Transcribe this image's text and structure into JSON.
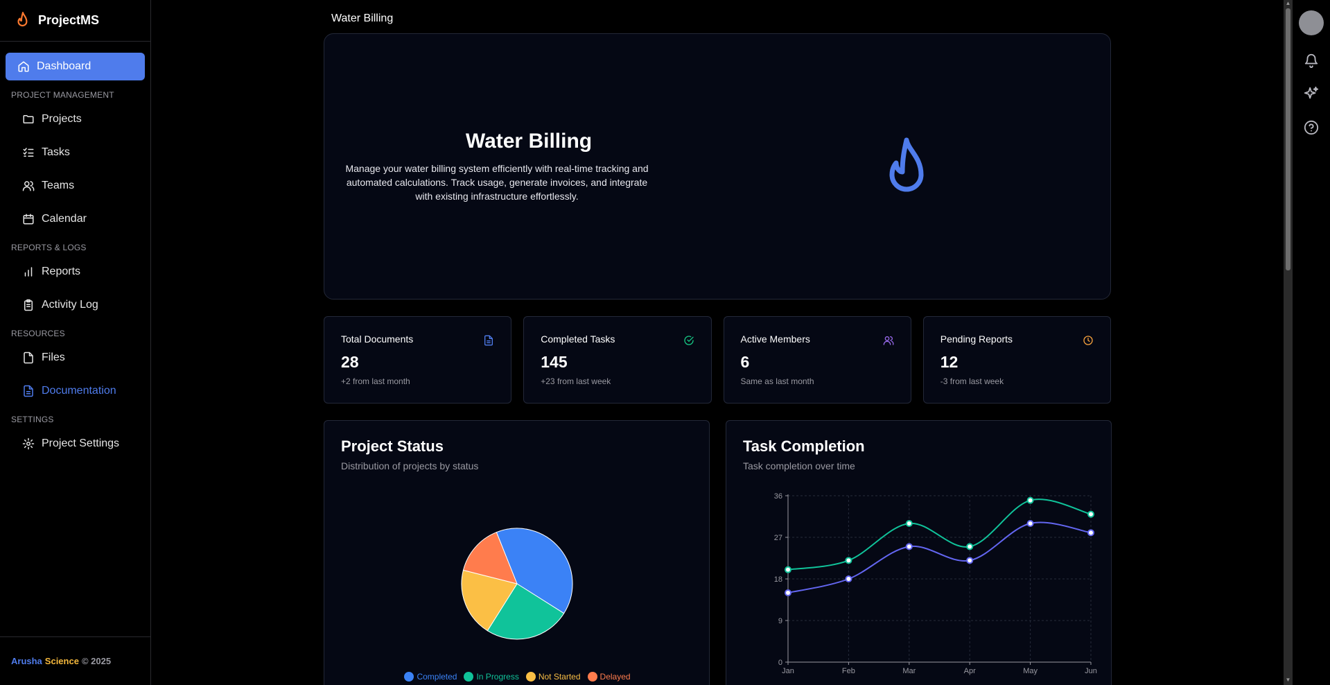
{
  "brand": {
    "name": "ProjectMS"
  },
  "sidebar": {
    "dashboard": "Dashboard",
    "sections": {
      "project_management": "PROJECT MANAGEMENT",
      "reports_logs": "REPORTS & LOGS",
      "resources": "RESOURCES",
      "settings": "SETTINGS"
    },
    "items": {
      "projects": "Projects",
      "tasks": "Tasks",
      "teams": "Teams",
      "calendar": "Calendar",
      "reports": "Reports",
      "activity_log": "Activity Log",
      "files": "Files",
      "documentation": "Documentation",
      "project_settings": "Project Settings"
    },
    "footer": {
      "arusha": "Arusha",
      "science": "Science",
      "copyright": "© 2025"
    }
  },
  "header": {
    "title": "Water Billing"
  },
  "hero": {
    "title": "Water Billing",
    "description": "Manage your water billing system efficiently with real-time tracking and automated calculations. Track usage, generate invoices, and integrate with existing infrastructure effortlessly."
  },
  "stats": [
    {
      "label": "Total Documents",
      "value": "28",
      "note": "+2 from last month",
      "icon": "document-icon",
      "color": "#4f7cec"
    },
    {
      "label": "Completed Tasks",
      "value": "145",
      "note": "+23 from last week",
      "icon": "check-circle-icon",
      "color": "#16c784"
    },
    {
      "label": "Active Members",
      "value": "6",
      "note": "Same as last month",
      "icon": "users-icon",
      "color": "#9b6cf0"
    },
    {
      "label": "Pending Reports",
      "value": "12",
      "note": "-3 from last week",
      "icon": "clock-icon",
      "color": "#f5a13d"
    }
  ],
  "project_status": {
    "title": "Project Status",
    "subtitle": "Distribution of projects by status"
  },
  "task_completion": {
    "title": "Task Completion",
    "subtitle": "Task completion over time"
  },
  "colors": {
    "accent": "#4f7cec",
    "completed": "#3b82f6",
    "in_progress": "#10c39a",
    "not_started": "#fbbf45",
    "delayed": "#ff7c4d",
    "series_a": "#10c39a",
    "series_b": "#6366f1"
  },
  "chart_data": [
    {
      "type": "pie",
      "categories": [
        "Completed",
        "In Progress",
        "Not Started",
        "Delayed"
      ],
      "values": [
        40,
        25,
        20,
        15
      ],
      "colors": [
        "#3b82f6",
        "#10c39a",
        "#fbbf45",
        "#ff7c4d"
      ],
      "legend": "bottom"
    },
    {
      "type": "line",
      "x": [
        "Jan",
        "Feb",
        "Mar",
        "Apr",
        "May",
        "Jun"
      ],
      "series": [
        {
          "values": [
            20,
            22,
            30,
            25,
            35,
            32
          ],
          "color": "#10c39a"
        },
        {
          "values": [
            15,
            18,
            25,
            22,
            30,
            28
          ],
          "color": "#6366f1"
        }
      ],
      "yticks": [
        0,
        9,
        18,
        27,
        36
      ],
      "ylim": [
        0,
        36
      ],
      "grid": true
    }
  ]
}
